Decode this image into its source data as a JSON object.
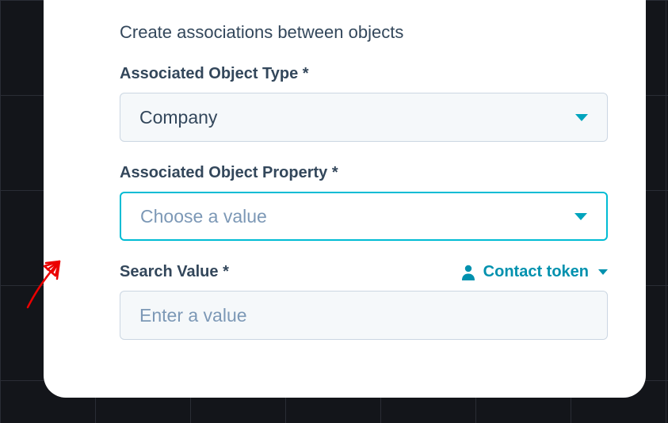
{
  "section": {
    "title": "Create associations between objects"
  },
  "objectType": {
    "label": "Associated Object Type *",
    "value": "Company"
  },
  "objectProperty": {
    "label": "Associated Object Property *",
    "placeholder": "Choose a value"
  },
  "searchValue": {
    "label": "Search Value *",
    "placeholder": "Enter a value",
    "tokenLabel": "Contact token"
  },
  "colors": {
    "accent": "#00a4bd",
    "focus": "#00bcd4",
    "text": "#33475b",
    "muted": "#7c98b6",
    "border": "#cbd6e2",
    "fieldBg": "#f5f8fa",
    "annotation": "#eb0000"
  }
}
